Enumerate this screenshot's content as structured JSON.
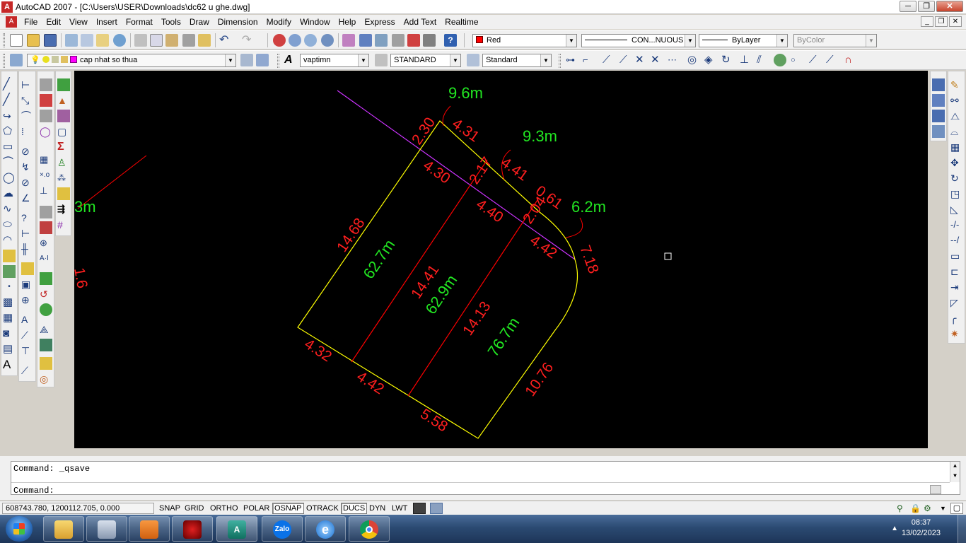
{
  "window": {
    "title": "AutoCAD 2007 - [C:\\Users\\USER\\Downloads\\dc62 u ghe.dwg]",
    "minimize": "─",
    "restore": "❐",
    "close": "✕"
  },
  "menu": [
    "File",
    "Edit",
    "View",
    "Insert",
    "Format",
    "Tools",
    "Draw",
    "Dimension",
    "Modify",
    "Window",
    "Help",
    "Express",
    "Add Text",
    "Realtime"
  ],
  "properties_bar": {
    "color": "Red",
    "linetype": "CON...NUOUS",
    "lineweight": "ByLayer",
    "plotstyle": "ByColor"
  },
  "layers_bar": {
    "layer": "cap nhat so thua",
    "text_style": "vaptimn",
    "dim_style": "STANDARD",
    "table_style": "Standard"
  },
  "drawing": {
    "area_labels": [
      "9.6m",
      "9.3m",
      "6.2m",
      "62.7m",
      "62.9m",
      "76.7m",
      "3m"
    ],
    "dimension_labels": [
      "2.30",
      "4.31",
      "4.30",
      "2.17",
      "4.41",
      "0.61",
      "4.40",
      "2.04",
      "4.42",
      "7.18",
      "14.68",
      "14.41",
      "14.13",
      "4.32",
      "4.42",
      "5.58",
      "10.76",
      "1.6"
    ],
    "colors": {
      "background": "#000000",
      "boundary": "#ffff00",
      "division": "#ff0000",
      "road_line": "#cc33ff",
      "area_text": "#22e622",
      "dim_text": "#ff1f1f"
    }
  },
  "command": {
    "history": "Command: _qsave",
    "prompt": "Command:"
  },
  "status": {
    "coords": "608743.780, 1200112.705, 0.000",
    "toggles": [
      {
        "label": "SNAP",
        "on": false
      },
      {
        "label": "GRID",
        "on": false
      },
      {
        "label": "ORTHO",
        "on": false
      },
      {
        "label": "POLAR",
        "on": false
      },
      {
        "label": "OSNAP",
        "on": true
      },
      {
        "label": "OTRACK",
        "on": false
      },
      {
        "label": "DUCS",
        "on": true
      },
      {
        "label": "DYN",
        "on": false
      },
      {
        "label": "LWT",
        "on": false
      }
    ]
  },
  "taskbar": {
    "apps": [
      "windows-explorer",
      "calculator",
      "media-player",
      "garena",
      "autocad",
      "zalo",
      "internet-explorer",
      "chrome"
    ],
    "zalo_label": "Zalo",
    "time": "08:37",
    "date": "13/02/2023"
  }
}
